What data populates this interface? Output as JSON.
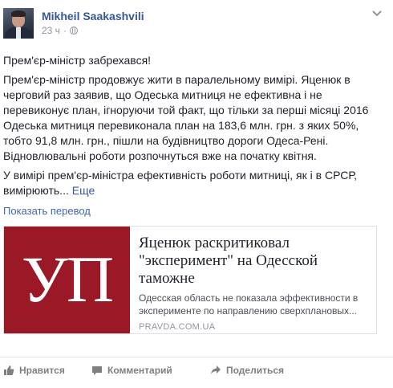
{
  "post": {
    "author": "Mikheil Saakashvili",
    "time": "23 ч",
    "separator": "·",
    "paragraph1": "Прем'єр-міністр забрехався!",
    "paragraph2_lines": [
      "Прем'єр-міністр продовжує жити в паралельному вимірі. Яценюк в",
      "черговий раз заявив, що Одеська митниця не ефективна і не",
      "перевиконує план, ігноруючи той факт, що тільки за перші місяці 2016",
      "Одеська митниця перевиконала план на 183,6 млн. грн. з яких 50%,",
      "тобто 91,8 млн. грн., пішли на будівництво дороги Одеса-Рені.",
      "Відновлювальні роботи розпочнуться вже на початку квітня."
    ],
    "paragraph3_lines": [
      "У вимірі прем'єр-міністра ефективність роботи митниці, як і в СРСР,",
      "вимірюють..."
    ],
    "see_more": "Еще",
    "translate": "Показать перевод"
  },
  "card": {
    "image_text": "УП",
    "title_lines": [
      "Яценюк раскритиковал",
      "\"эксперимент\" на Одесской",
      "таможне"
    ],
    "description_lines": [
      "Одесская область не показала эффективности в",
      "эксперименте по направлению сверхплановых..."
    ],
    "domain": "PRAVDA.COM.UA"
  },
  "actions": {
    "like": "Нравится",
    "comment": "Комментарий",
    "share": "Поделиться"
  },
  "colors": {
    "link_blue": "#365899",
    "card_red": "#9b1826",
    "muted_gray": "#90949c"
  }
}
